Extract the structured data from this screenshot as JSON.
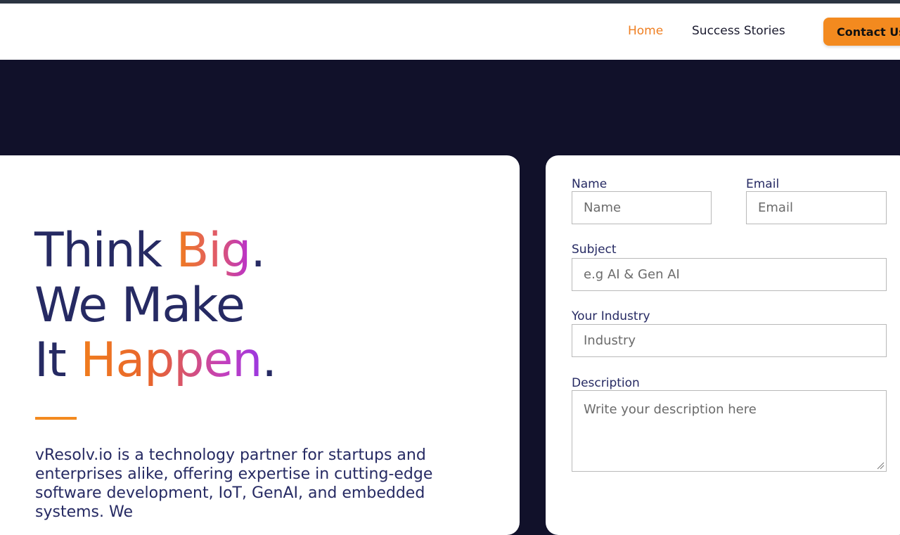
{
  "nav": {
    "home": "Home",
    "success_stories": "Success Stories",
    "contact": "Contact Us"
  },
  "hero": {
    "line1_a": "Think ",
    "line1_b": "Big",
    "line1_c": ".",
    "line2": "We Make",
    "line3_a": "It ",
    "line3_b": "Happen",
    "line3_c": ".",
    "intro": "vResolv.io is a technology partner for startups and enterprises alike, offering expertise in cutting-edge software development, IoT, GenAI, and embedded systems. We"
  },
  "form": {
    "name_label": "Name",
    "name_placeholder": "Name",
    "email_label": "Email",
    "email_placeholder": "Email",
    "subject_label": "Subject",
    "subject_placeholder": "e.g AI & Gen AI",
    "industry_label": "Your Industry",
    "industry_placeholder": "Industry",
    "description_label": "Description",
    "description_placeholder": "Write your description here"
  },
  "colors": {
    "accent": "#f38a1f",
    "navy_text": "#262a63",
    "dark_bg": "#11112a"
  }
}
